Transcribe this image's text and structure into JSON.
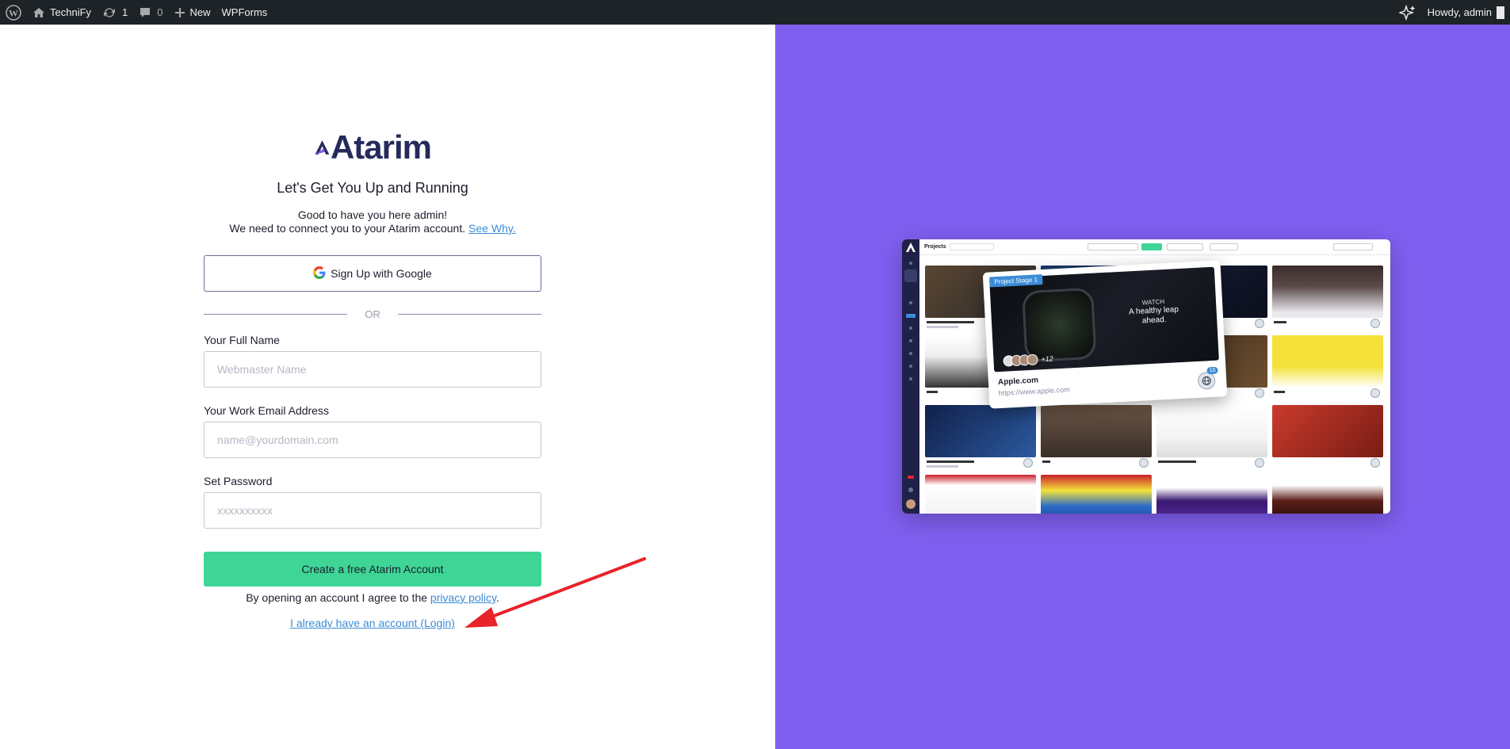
{
  "adminbar": {
    "site_name": "TechniFy",
    "updates_count": "1",
    "comments_count": "0",
    "new_label": "New",
    "wpforms_label": "WPForms",
    "howdy": "Howdy, admin"
  },
  "form": {
    "logo_text": "Atarim",
    "title": "Let's Get You Up and Running",
    "greeting": "Good to have you here admin!",
    "connect_text": "We need to connect you to your Atarim account.",
    "see_why": "See Why.",
    "google_button": "Sign Up with Google",
    "or_text": "OR",
    "full_name_label": "Your Full Name",
    "full_name_placeholder": "Webmaster Name",
    "email_label": "Your Work Email Address",
    "email_placeholder": "name@yourdomain.com",
    "password_label": "Set Password",
    "password_placeholder": "xxxxxxxxxx",
    "create_button": "Create a free Atarim Account",
    "agree_text": "By opening an account I agree to the",
    "privacy_link": "privacy policy",
    "agree_period": ".",
    "login_link": "I already have an account (Login)"
  },
  "preview": {
    "projects_label": "Projects",
    "popup_tag": "Project Stage 1",
    "popup_brand": "WATCH",
    "popup_headline": "A healthy leap ahead.",
    "popup_site_name": "Apple.com",
    "popup_site_url": "https://www.apple.com",
    "popup_more": "+12",
    "popup_badge": "15"
  },
  "colors": {
    "accent_green": "#3ed597",
    "right_panel": "#7f5ff0",
    "link_blue": "#3a8cd6",
    "adminbar_bg": "#1d2327",
    "annotation_arrow": "#e8232a"
  },
  "icons": [
    "wordpress-icon",
    "home-icon",
    "updates-icon",
    "comment-icon",
    "plus-icon",
    "sparkle-icon",
    "google-icon",
    "globe-icon"
  ]
}
